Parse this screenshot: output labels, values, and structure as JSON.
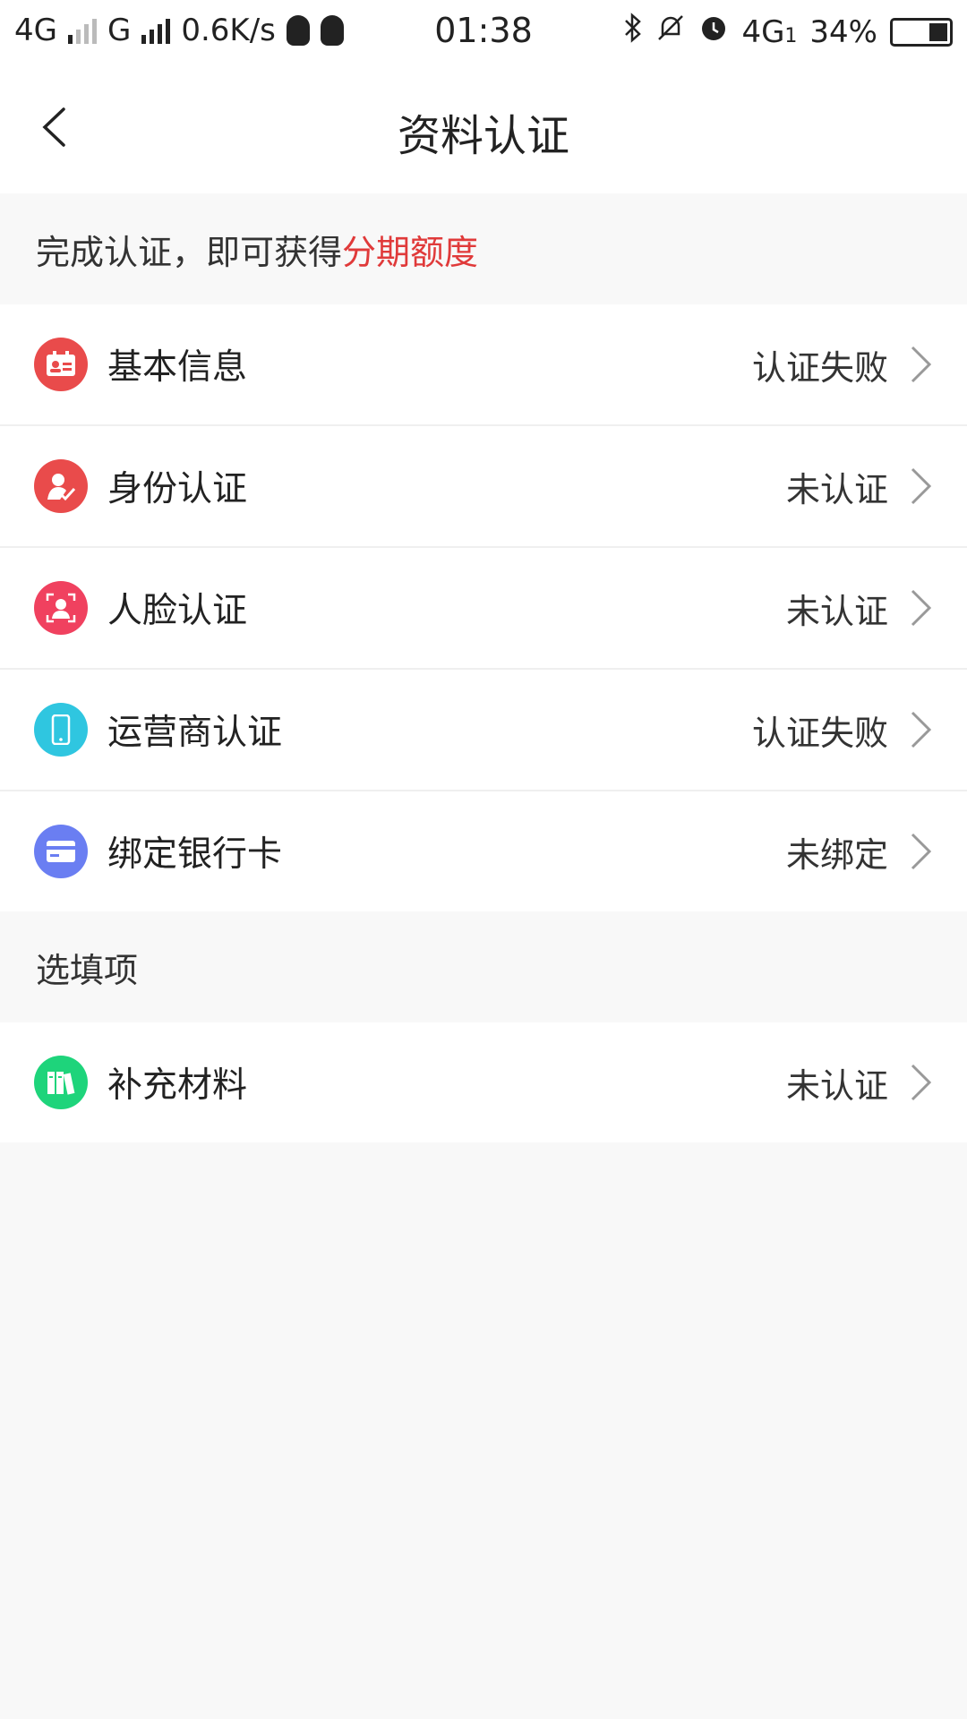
{
  "status_bar": {
    "left_network": "4G",
    "left_network2": "G",
    "speed": "0.6K/s",
    "time": "01:38",
    "right_network": "4G",
    "right_network_sub": "1",
    "battery_percent": "34%"
  },
  "header": {
    "title": "资料认证"
  },
  "hint": {
    "prefix": "完成认证，即可获得",
    "accent_text": "分期额度"
  },
  "items": [
    {
      "label": "基本信息",
      "status": "认证失败",
      "icon": "id-card-icon",
      "color": "#e94b4b"
    },
    {
      "label": "身份认证",
      "status": "未认证",
      "icon": "user-check-icon",
      "color": "#e94b4b"
    },
    {
      "label": "人脸认证",
      "status": "未认证",
      "icon": "face-scan-icon",
      "color": "#f0415f"
    },
    {
      "label": "运营商认证",
      "status": "认证失败",
      "icon": "phone-icon",
      "color": "#2fc6e0"
    },
    {
      "label": "绑定银行卡",
      "status": "未绑定",
      "icon": "bank-card-icon",
      "color": "#6a7ef2"
    }
  ],
  "optional_section": {
    "title": "选填项"
  },
  "optional_items": [
    {
      "label": "补充材料",
      "status": "未认证",
      "icon": "books-icon",
      "color": "#1ed47b"
    }
  ]
}
